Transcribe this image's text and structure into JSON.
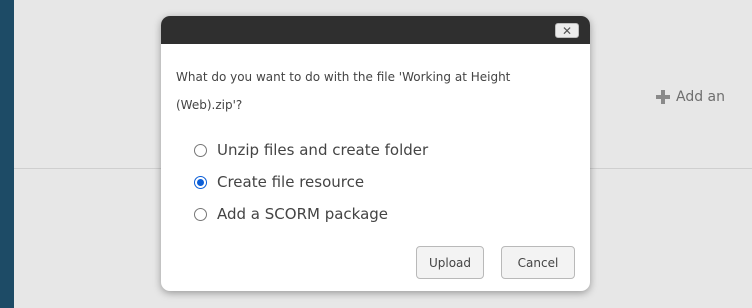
{
  "background": {
    "add_label": "Add an"
  },
  "dialog": {
    "close_label": "✕",
    "message": "What do you want to do with the file 'Working at Height (Web).zip'?",
    "options": [
      {
        "label": "Unzip files and create folder",
        "selected": false
      },
      {
        "label": "Create file resource",
        "selected": true
      },
      {
        "label": "Add a SCORM package",
        "selected": false
      }
    ],
    "buttons": {
      "upload": "Upload",
      "cancel": "Cancel"
    }
  },
  "colors": {
    "outer_background": "#1d4b66",
    "page_background": "#e7e7e7",
    "titlebar": "#2f2f2f",
    "radio_selected": "#0b5ed7"
  },
  "icons": {
    "add": "plus-icon",
    "close": "close-icon",
    "radio": "radio-icon"
  }
}
